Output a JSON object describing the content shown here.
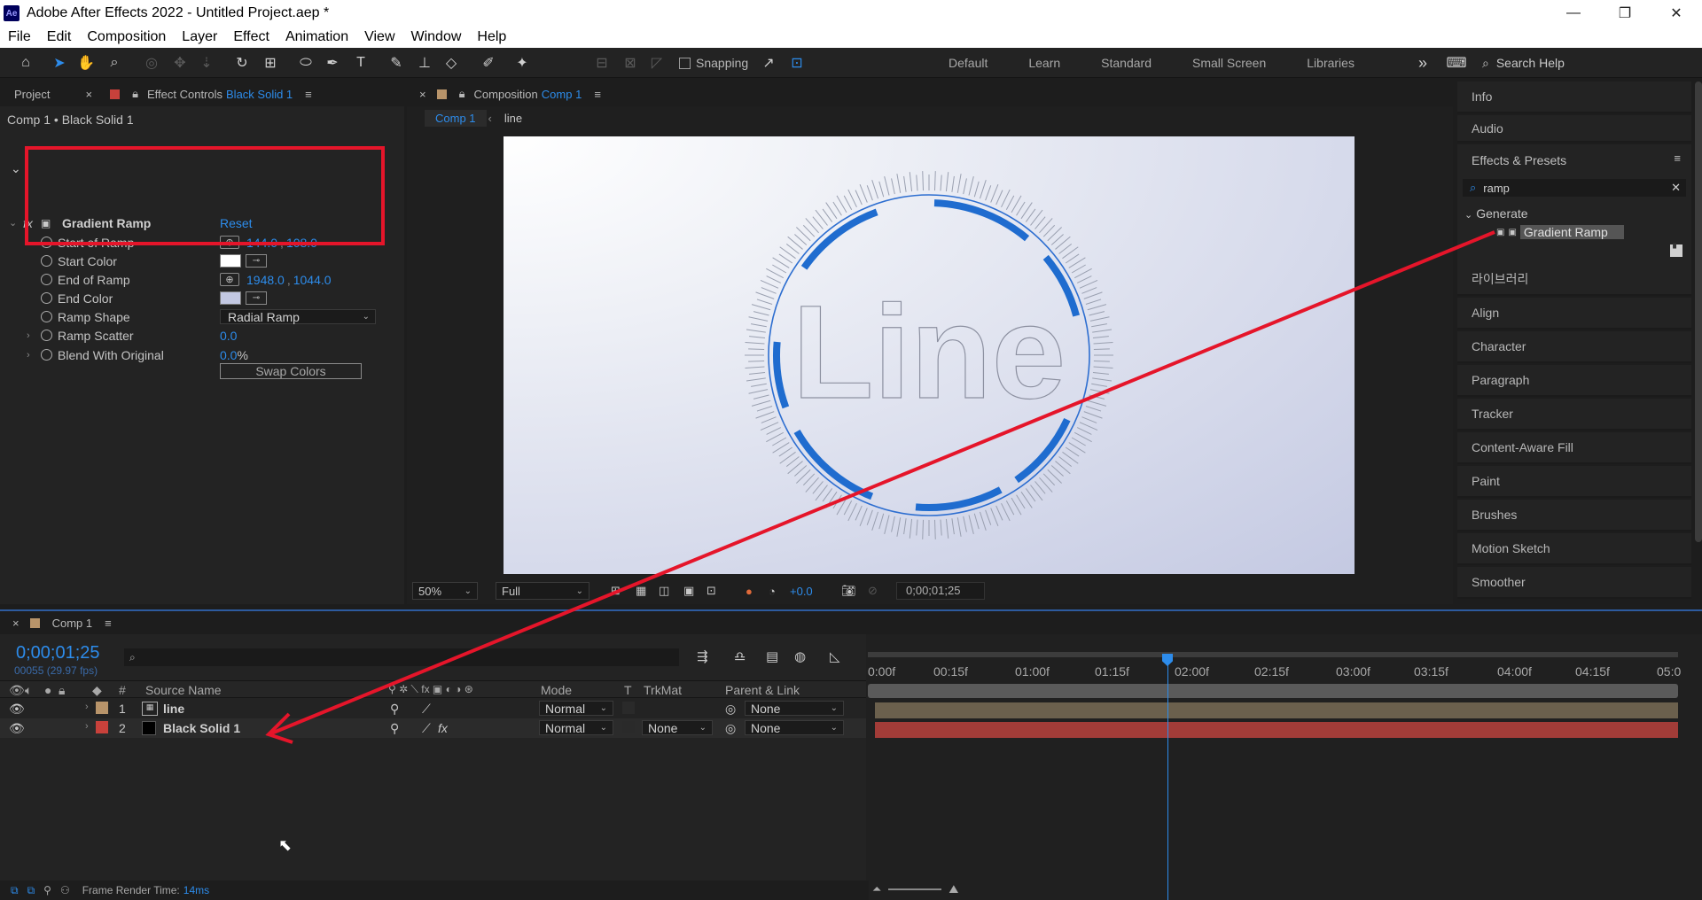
{
  "window": {
    "logo": "Ae",
    "title": "Adobe After Effects 2022 - Untitled Project.aep *",
    "min": "—",
    "max": "❐",
    "close": "✕"
  },
  "menu": [
    "File",
    "Edit",
    "Composition",
    "Layer",
    "Effect",
    "Animation",
    "View",
    "Window",
    "Help"
  ],
  "toolbar": {
    "snapping": "Snapping",
    "workspaces": [
      "Default",
      "Learn",
      "Standard",
      "Small Screen",
      "Libraries"
    ],
    "more": "»",
    "search_help": "Search Help"
  },
  "effect_panel": {
    "tab_project": "Project",
    "tab_effect_controls": "Effect Controls",
    "tab_layer": "Black Solid 1",
    "subtitle": "Comp 1 • Black Solid 1",
    "effect_name": "Gradient Ramp",
    "reset": "Reset",
    "props": {
      "start_of_ramp": {
        "label": "Start of Ramp",
        "x": "144.0",
        "y": "108.0"
      },
      "start_color": {
        "label": "Start Color",
        "color": "#ffffff"
      },
      "end_of_ramp": {
        "label": "End of Ramp",
        "x": "1948.0",
        "y": "1044.0"
      },
      "end_color": {
        "label": "End Color",
        "color": "#c3c8e2"
      },
      "ramp_shape": {
        "label": "Ramp Shape",
        "value": "Radial Ramp"
      },
      "ramp_scatter": {
        "label": "Ramp Scatter",
        "value": "0.0"
      },
      "blend": {
        "label": "Blend With Original",
        "value": "0.0",
        "unit": "%"
      }
    },
    "swap_colors": "Swap Colors"
  },
  "comp_panel": {
    "tab_prefix": "Composition",
    "tab_name": "Comp 1",
    "subtabs": [
      "Comp 1",
      "line"
    ],
    "artwork_text": "Line",
    "zoom": "50%",
    "resolution": "Full",
    "exposure": "+0.0",
    "timecode": "0;00;01;25"
  },
  "right_panel": {
    "info": "Info",
    "audio": "Audio",
    "effects_presets": "Effects & Presets",
    "search_value": "ramp",
    "category": "Generate",
    "effect_item": "Gradient Ramp",
    "items": [
      "라이브러리",
      "Align",
      "Character",
      "Paragraph",
      "Tracker",
      "Content-Aware Fill",
      "Paint",
      "Brushes",
      "Motion Sketch",
      "Smoother"
    ]
  },
  "timeline": {
    "tab": "Comp 1",
    "timecode": "0;00;01;25",
    "fps": "00055 (29.97 fps)",
    "search_icon": "⌕",
    "headers": {
      "num": "#",
      "source": "Source Name",
      "mode": "Mode",
      "t": "T",
      "trkmat": "TrkMat",
      "parent": "Parent & Link"
    },
    "layers": [
      {
        "num": "1",
        "name": "line",
        "mode": "Normal",
        "trkmat": "",
        "parent": "None",
        "color": "#b8946a",
        "bar": "#6b604d"
      },
      {
        "num": "2",
        "name": "Black Solid 1",
        "mode": "Normal",
        "trkmat": "None",
        "parent": "None",
        "color": "#c8413b",
        "bar": "#a23c38"
      }
    ],
    "ruler": [
      "0:00f",
      "00:15f",
      "01:00f",
      "01:15f",
      "02:00f",
      "02:15f",
      "03:00f",
      "03:15f",
      "04:00f",
      "04:15f",
      "05:0"
    ],
    "status_label": "Frame Render Time:",
    "status_value": "14ms"
  },
  "colors": {
    "accent": "#2d8ceb",
    "annotation": "#e5152a"
  }
}
